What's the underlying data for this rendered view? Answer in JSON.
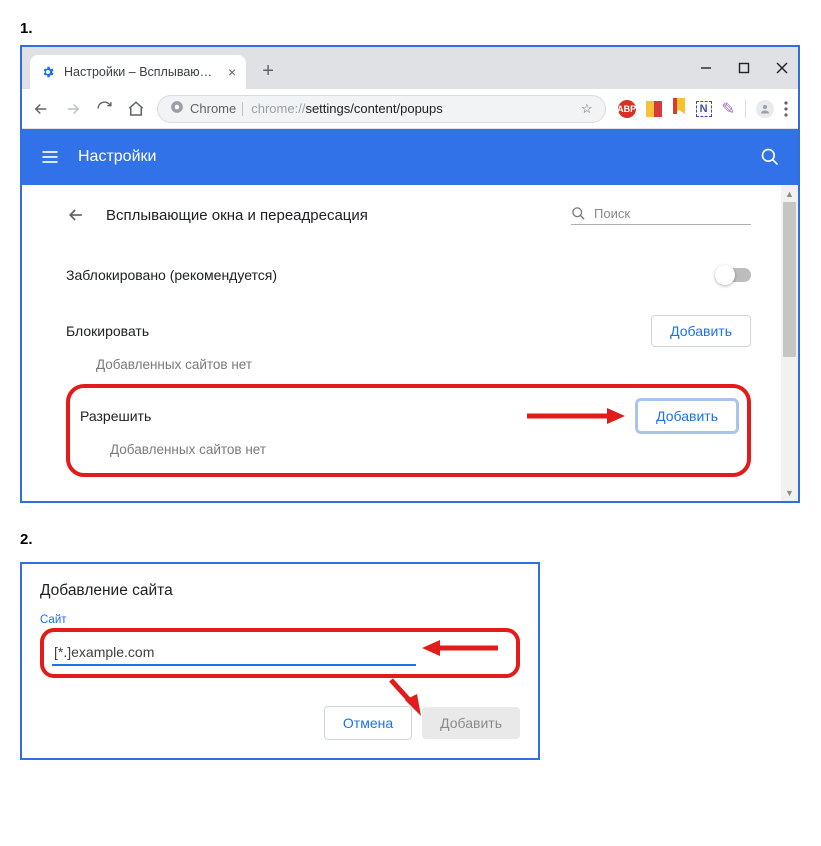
{
  "step1_label": "1.",
  "step2_label": "2.",
  "tab": {
    "title": "Настройки – Всплывающие окн"
  },
  "address": {
    "secure_label": "Chrome",
    "url_prefix": "chrome://",
    "url_path": "settings/content/popups"
  },
  "header": {
    "title": "Настройки"
  },
  "page": {
    "title": "Всплывающие окна и переадресация",
    "search_placeholder": "Поиск",
    "blocked_label": "Заблокировано (рекомендуется)",
    "block_section_title": "Блокировать",
    "allow_section_title": "Разрешить",
    "add_button": "Добавить",
    "no_sites": "Добавленных сайтов нет"
  },
  "dialog": {
    "title": "Добавление сайта",
    "field_label": "Сайт",
    "input_value": "[*.]example.com",
    "cancel": "Отмена",
    "add": "Добавить"
  },
  "ext": {
    "abp": "ABP",
    "n": "N"
  }
}
